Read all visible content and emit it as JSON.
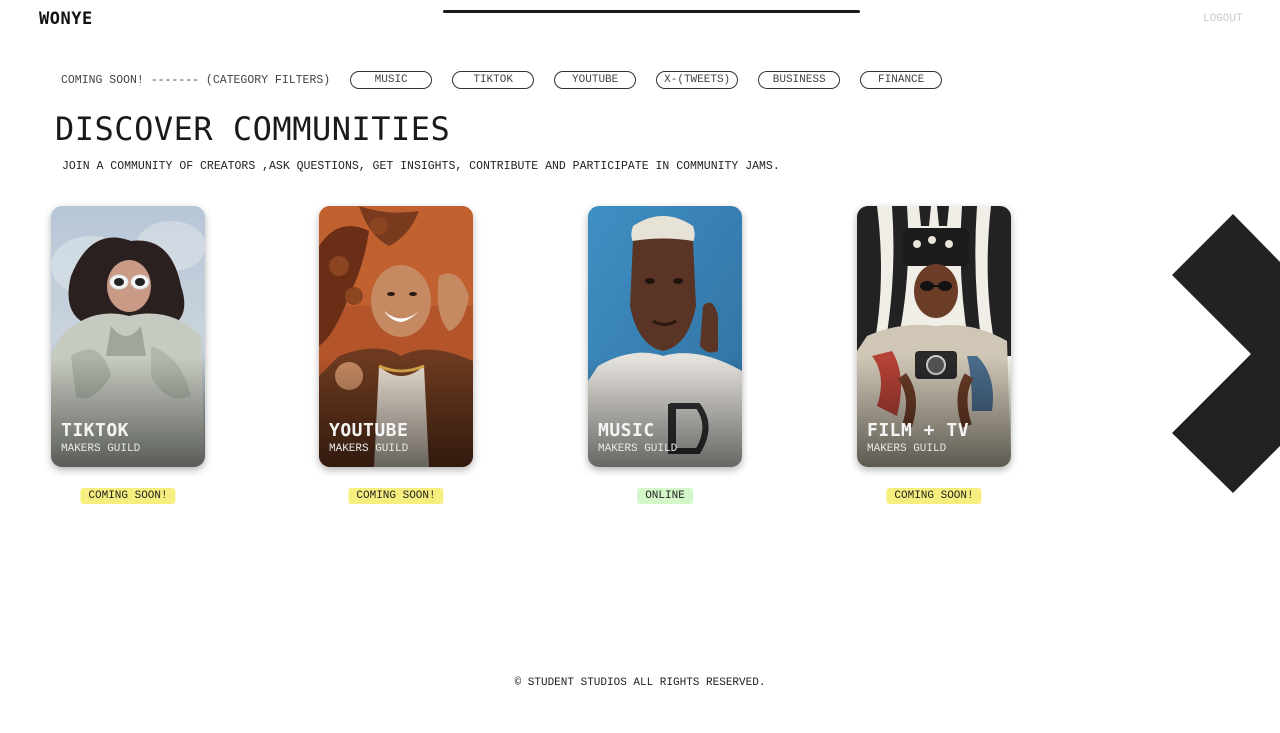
{
  "header": {
    "logo": "WONYE",
    "logout_label": "LOGOUT"
  },
  "filters": {
    "label": "COMING SOON! ------- (CATEGORY FILTERS)",
    "chips": [
      "MUSIC",
      "TIKTOK",
      "YOUTUBE",
      "X-(TWEETS)",
      "BUSINESS",
      "FINANCE"
    ]
  },
  "main": {
    "title": "DISCOVER COMMUNITIES",
    "subtitle": "JOIN A COMMUNITY OF CREATORS ,ASK QUESTIONS, GET INSIGHTS, CONTRIBUTE AND PARTICIPATE IN COMMUNITY JAMS."
  },
  "cards": [
    {
      "title": "TIKTOK",
      "subtitle": "MAKERS GUILD",
      "status": "COMING SOON!",
      "status_color": "#f6ef7f",
      "image": "woman-white-sunglasses-fur-coat"
    },
    {
      "title": "YOUTUBE",
      "subtitle": "MAKERS GUILD",
      "status": "COMING SOON!",
      "status_color": "#f6ef7f",
      "image": "woman-braids-orange-background"
    },
    {
      "title": "MUSIC",
      "subtitle": "MAKERS GUILD",
      "status": "ONLINE",
      "status_color": "#d4f7c9",
      "image": "man-blue-background"
    },
    {
      "title": "FILM + TV",
      "subtitle": "MAKERS GUILD",
      "status": "COMING SOON!",
      "status_color": "#f6ef7f",
      "image": "man-camera-zebra-background"
    }
  ],
  "footer": {
    "text": "© STUDENT STUDIOS ALL RIGHTS RESERVED."
  },
  "colors": {
    "text": "#1a1a1a",
    "logout": "#c9c9c9",
    "arrow": "#222222"
  },
  "icons": {
    "carousel_next": "chevron-right-icon"
  }
}
